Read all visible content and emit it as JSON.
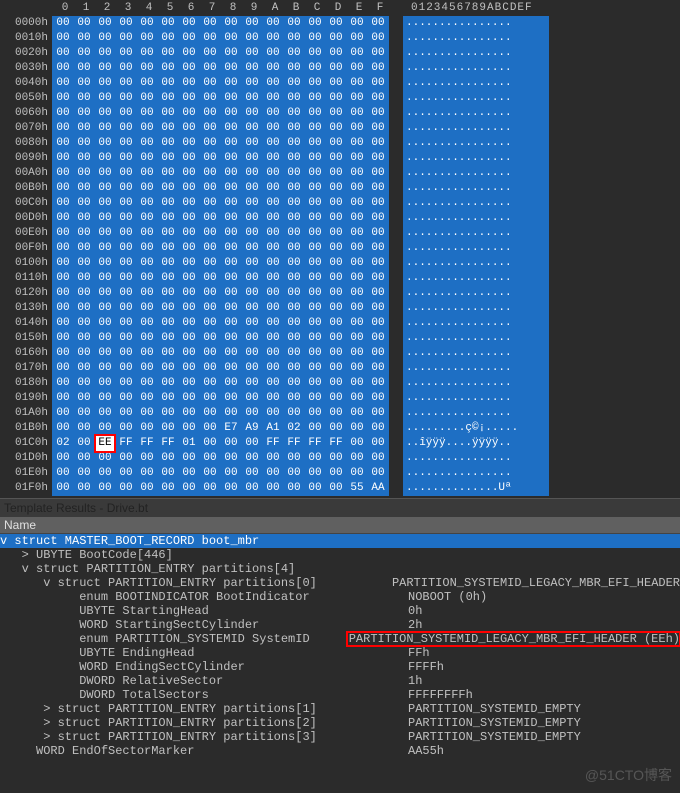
{
  "hex": {
    "col_labels": [
      "0",
      "1",
      "2",
      "3",
      "4",
      "5",
      "6",
      "7",
      "8",
      "9",
      "A",
      "B",
      "C",
      "D",
      "E",
      "F"
    ],
    "ascii_header": "0123456789ABCDEF",
    "highlight": {
      "row": "01C0h",
      "byte_index": 2
    },
    "rows": [
      {
        "off": "0000h",
        "b": [
          "00",
          "00",
          "00",
          "00",
          "00",
          "00",
          "00",
          "00",
          "00",
          "00",
          "00",
          "00",
          "00",
          "00",
          "00",
          "00"
        ],
        "a": "................"
      },
      {
        "off": "0010h",
        "b": [
          "00",
          "00",
          "00",
          "00",
          "00",
          "00",
          "00",
          "00",
          "00",
          "00",
          "00",
          "00",
          "00",
          "00",
          "00",
          "00"
        ],
        "a": "................"
      },
      {
        "off": "0020h",
        "b": [
          "00",
          "00",
          "00",
          "00",
          "00",
          "00",
          "00",
          "00",
          "00",
          "00",
          "00",
          "00",
          "00",
          "00",
          "00",
          "00"
        ],
        "a": "................"
      },
      {
        "off": "0030h",
        "b": [
          "00",
          "00",
          "00",
          "00",
          "00",
          "00",
          "00",
          "00",
          "00",
          "00",
          "00",
          "00",
          "00",
          "00",
          "00",
          "00"
        ],
        "a": "................"
      },
      {
        "off": "0040h",
        "b": [
          "00",
          "00",
          "00",
          "00",
          "00",
          "00",
          "00",
          "00",
          "00",
          "00",
          "00",
          "00",
          "00",
          "00",
          "00",
          "00"
        ],
        "a": "................"
      },
      {
        "off": "0050h",
        "b": [
          "00",
          "00",
          "00",
          "00",
          "00",
          "00",
          "00",
          "00",
          "00",
          "00",
          "00",
          "00",
          "00",
          "00",
          "00",
          "00"
        ],
        "a": "................"
      },
      {
        "off": "0060h",
        "b": [
          "00",
          "00",
          "00",
          "00",
          "00",
          "00",
          "00",
          "00",
          "00",
          "00",
          "00",
          "00",
          "00",
          "00",
          "00",
          "00"
        ],
        "a": "................"
      },
      {
        "off": "0070h",
        "b": [
          "00",
          "00",
          "00",
          "00",
          "00",
          "00",
          "00",
          "00",
          "00",
          "00",
          "00",
          "00",
          "00",
          "00",
          "00",
          "00"
        ],
        "a": "................"
      },
      {
        "off": "0080h",
        "b": [
          "00",
          "00",
          "00",
          "00",
          "00",
          "00",
          "00",
          "00",
          "00",
          "00",
          "00",
          "00",
          "00",
          "00",
          "00",
          "00"
        ],
        "a": "................"
      },
      {
        "off": "0090h",
        "b": [
          "00",
          "00",
          "00",
          "00",
          "00",
          "00",
          "00",
          "00",
          "00",
          "00",
          "00",
          "00",
          "00",
          "00",
          "00",
          "00"
        ],
        "a": "................"
      },
      {
        "off": "00A0h",
        "b": [
          "00",
          "00",
          "00",
          "00",
          "00",
          "00",
          "00",
          "00",
          "00",
          "00",
          "00",
          "00",
          "00",
          "00",
          "00",
          "00"
        ],
        "a": "................"
      },
      {
        "off": "00B0h",
        "b": [
          "00",
          "00",
          "00",
          "00",
          "00",
          "00",
          "00",
          "00",
          "00",
          "00",
          "00",
          "00",
          "00",
          "00",
          "00",
          "00"
        ],
        "a": "................"
      },
      {
        "off": "00C0h",
        "b": [
          "00",
          "00",
          "00",
          "00",
          "00",
          "00",
          "00",
          "00",
          "00",
          "00",
          "00",
          "00",
          "00",
          "00",
          "00",
          "00"
        ],
        "a": "................"
      },
      {
        "off": "00D0h",
        "b": [
          "00",
          "00",
          "00",
          "00",
          "00",
          "00",
          "00",
          "00",
          "00",
          "00",
          "00",
          "00",
          "00",
          "00",
          "00",
          "00"
        ],
        "a": "................"
      },
      {
        "off": "00E0h",
        "b": [
          "00",
          "00",
          "00",
          "00",
          "00",
          "00",
          "00",
          "00",
          "00",
          "00",
          "00",
          "00",
          "00",
          "00",
          "00",
          "00"
        ],
        "a": "................"
      },
      {
        "off": "00F0h",
        "b": [
          "00",
          "00",
          "00",
          "00",
          "00",
          "00",
          "00",
          "00",
          "00",
          "00",
          "00",
          "00",
          "00",
          "00",
          "00",
          "00"
        ],
        "a": "................"
      },
      {
        "off": "0100h",
        "b": [
          "00",
          "00",
          "00",
          "00",
          "00",
          "00",
          "00",
          "00",
          "00",
          "00",
          "00",
          "00",
          "00",
          "00",
          "00",
          "00"
        ],
        "a": "................"
      },
      {
        "off": "0110h",
        "b": [
          "00",
          "00",
          "00",
          "00",
          "00",
          "00",
          "00",
          "00",
          "00",
          "00",
          "00",
          "00",
          "00",
          "00",
          "00",
          "00"
        ],
        "a": "................"
      },
      {
        "off": "0120h",
        "b": [
          "00",
          "00",
          "00",
          "00",
          "00",
          "00",
          "00",
          "00",
          "00",
          "00",
          "00",
          "00",
          "00",
          "00",
          "00",
          "00"
        ],
        "a": "................"
      },
      {
        "off": "0130h",
        "b": [
          "00",
          "00",
          "00",
          "00",
          "00",
          "00",
          "00",
          "00",
          "00",
          "00",
          "00",
          "00",
          "00",
          "00",
          "00",
          "00"
        ],
        "a": "................"
      },
      {
        "off": "0140h",
        "b": [
          "00",
          "00",
          "00",
          "00",
          "00",
          "00",
          "00",
          "00",
          "00",
          "00",
          "00",
          "00",
          "00",
          "00",
          "00",
          "00"
        ],
        "a": "................"
      },
      {
        "off": "0150h",
        "b": [
          "00",
          "00",
          "00",
          "00",
          "00",
          "00",
          "00",
          "00",
          "00",
          "00",
          "00",
          "00",
          "00",
          "00",
          "00",
          "00"
        ],
        "a": "................"
      },
      {
        "off": "0160h",
        "b": [
          "00",
          "00",
          "00",
          "00",
          "00",
          "00",
          "00",
          "00",
          "00",
          "00",
          "00",
          "00",
          "00",
          "00",
          "00",
          "00"
        ],
        "a": "................"
      },
      {
        "off": "0170h",
        "b": [
          "00",
          "00",
          "00",
          "00",
          "00",
          "00",
          "00",
          "00",
          "00",
          "00",
          "00",
          "00",
          "00",
          "00",
          "00",
          "00"
        ],
        "a": "................"
      },
      {
        "off": "0180h",
        "b": [
          "00",
          "00",
          "00",
          "00",
          "00",
          "00",
          "00",
          "00",
          "00",
          "00",
          "00",
          "00",
          "00",
          "00",
          "00",
          "00"
        ],
        "a": "................"
      },
      {
        "off": "0190h",
        "b": [
          "00",
          "00",
          "00",
          "00",
          "00",
          "00",
          "00",
          "00",
          "00",
          "00",
          "00",
          "00",
          "00",
          "00",
          "00",
          "00"
        ],
        "a": "................"
      },
      {
        "off": "01A0h",
        "b": [
          "00",
          "00",
          "00",
          "00",
          "00",
          "00",
          "00",
          "00",
          "00",
          "00",
          "00",
          "00",
          "00",
          "00",
          "00",
          "00"
        ],
        "a": "................"
      },
      {
        "off": "01B0h",
        "b": [
          "00",
          "00",
          "00",
          "00",
          "00",
          "00",
          "00",
          "00",
          "E7",
          "A9",
          "A1",
          "02",
          "00",
          "00",
          "00",
          "00"
        ],
        "a": ".........ç©¡....."
      },
      {
        "off": "01C0h",
        "b": [
          "02",
          "00",
          "EE",
          "FF",
          "FF",
          "FF",
          "01",
          "00",
          "00",
          "00",
          "FF",
          "FF",
          "FF",
          "FF",
          "00",
          "00"
        ],
        "a": "..îÿÿÿ....ÿÿÿÿ.."
      },
      {
        "off": "01D0h",
        "b": [
          "00",
          "00",
          "00",
          "00",
          "00",
          "00",
          "00",
          "00",
          "00",
          "00",
          "00",
          "00",
          "00",
          "00",
          "00",
          "00"
        ],
        "a": "................"
      },
      {
        "off": "01E0h",
        "b": [
          "00",
          "00",
          "00",
          "00",
          "00",
          "00",
          "00",
          "00",
          "00",
          "00",
          "00",
          "00",
          "00",
          "00",
          "00",
          "00"
        ],
        "a": "................"
      },
      {
        "off": "01F0h",
        "b": [
          "00",
          "00",
          "00",
          "00",
          "00",
          "00",
          "00",
          "00",
          "00",
          "00",
          "00",
          "00",
          "00",
          "00",
          "55",
          "AA"
        ],
        "a": "..............Uª"
      }
    ]
  },
  "panel": {
    "title": "Template Results - Drive.bt",
    "header": "Name"
  },
  "tree": {
    "sel": {
      "name": "struct MASTER_BOOT_RECORD boot_mbr",
      "val": "",
      "toggle": "v",
      "ind": 0,
      "selected": true
    },
    "rows": [
      {
        "toggle": ">",
        "ind": 1,
        "name": "UBYTE BootCode[446]",
        "val": ""
      },
      {
        "toggle": "v",
        "ind": 1,
        "name": "struct PARTITION_ENTRY partitions[4]",
        "val": ""
      },
      {
        "toggle": "v",
        "ind": 2,
        "name": "struct PARTITION_ENTRY partitions[0]",
        "val": "PARTITION_SYSTEMID_LEGACY_MBR_EFI_HEADER"
      },
      {
        "toggle": " ",
        "ind": 3,
        "name": "enum BOOTINDICATOR BootIndicator",
        "val": "NOBOOT (0h)"
      },
      {
        "toggle": " ",
        "ind": 3,
        "name": "UBYTE StartingHead",
        "val": "0h"
      },
      {
        "toggle": " ",
        "ind": 3,
        "name": "WORD StartingSectCylinder",
        "val": "2h"
      },
      {
        "toggle": " ",
        "ind": 3,
        "name": "enum PARTITION_SYSTEMID SystemID",
        "val": "PARTITION_SYSTEMID_LEGACY_MBR_EFI_HEADER (EEh)",
        "hilite": true
      },
      {
        "toggle": " ",
        "ind": 3,
        "name": "UBYTE EndingHead",
        "val": "FFh"
      },
      {
        "toggle": " ",
        "ind": 3,
        "name": "WORD EndingSectCylinder",
        "val": "FFFFh"
      },
      {
        "toggle": " ",
        "ind": 3,
        "name": "DWORD RelativeSector",
        "val": "1h"
      },
      {
        "toggle": " ",
        "ind": 3,
        "name": "DWORD TotalSectors",
        "val": "FFFFFFFFh"
      },
      {
        "toggle": ">",
        "ind": 2,
        "name": "struct PARTITION_ENTRY partitions[1]",
        "val": "PARTITION_SYSTEMID_EMPTY"
      },
      {
        "toggle": ">",
        "ind": 2,
        "name": "struct PARTITION_ENTRY partitions[2]",
        "val": "PARTITION_SYSTEMID_EMPTY"
      },
      {
        "toggle": ">",
        "ind": 2,
        "name": "struct PARTITION_ENTRY partitions[3]",
        "val": "PARTITION_SYSTEMID_EMPTY"
      },
      {
        "toggle": " ",
        "ind": 1,
        "name": "WORD EndOfSectorMarker",
        "val": "AA55h"
      }
    ]
  },
  "watermark": "@51CTO博客"
}
